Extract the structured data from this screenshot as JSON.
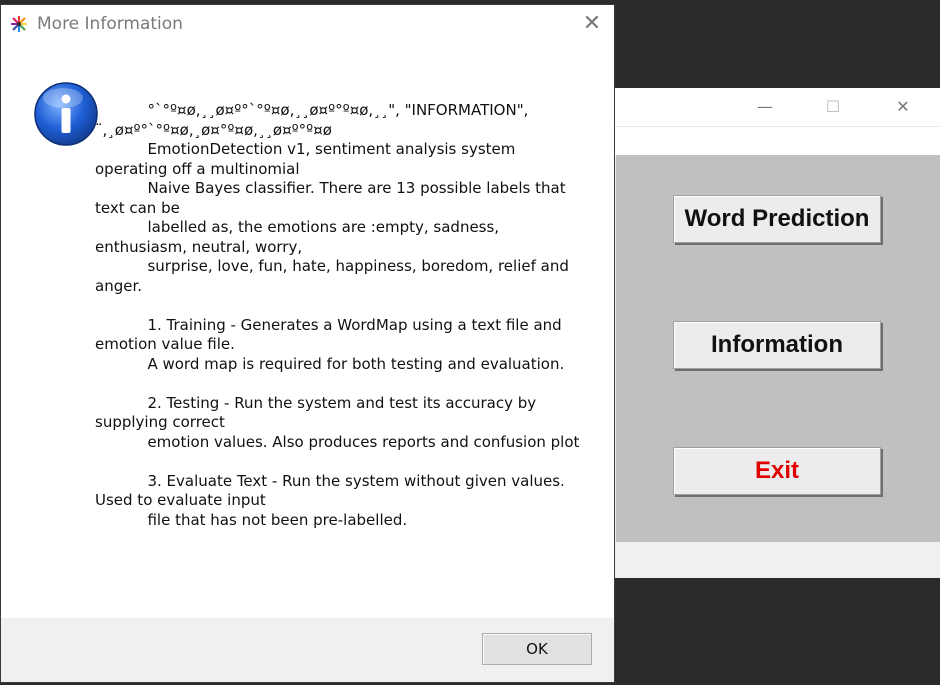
{
  "app_window": {
    "controls": {
      "minimize": "—",
      "maximize": "☐",
      "close": "✕"
    },
    "buttons": [
      {
        "label": "Word Prediction",
        "color": "#111111"
      },
      {
        "label": "Information",
        "color": "#111111"
      },
      {
        "label": "Exit",
        "color": "#e00000"
      }
    ]
  },
  "dialog": {
    "title": "More Information",
    "close_glyph": "✕",
    "icon": "info-icon",
    "message": "           °`°º¤ø,¸¸ø¤º°`°º¤ø,¸¸ø¤º°º¤ø,¸¸\", \"INFORMATION\",\n¨,¸ø¤º°`°º¤ø,¸ø¤°º¤ø,¸¸ø¤º°º¤ø\n           EmotionDetection v1, sentiment analysis system operating off a multinomial\n           Naive Bayes classifier. There are 13 possible labels that text can be\n           labelled as, the emotions are :empty, sadness, enthusiasm, neutral, worry,\n           surprise, love, fun, hate, happiness, boredom, relief and anger.\n\n           1. Training - Generates a WordMap using a text file and emotion value file.\n           A word map is required for both testing and evaluation.\n\n           2. Testing - Run the system and test its accuracy by supplying correct\n           emotion values. Also produces reports and confusion plot\n\n           3. Evaluate Text - Run the system without given values. Used to evaluate input\n           file that has not been pre-labelled.",
    "ok_label": "OK"
  }
}
